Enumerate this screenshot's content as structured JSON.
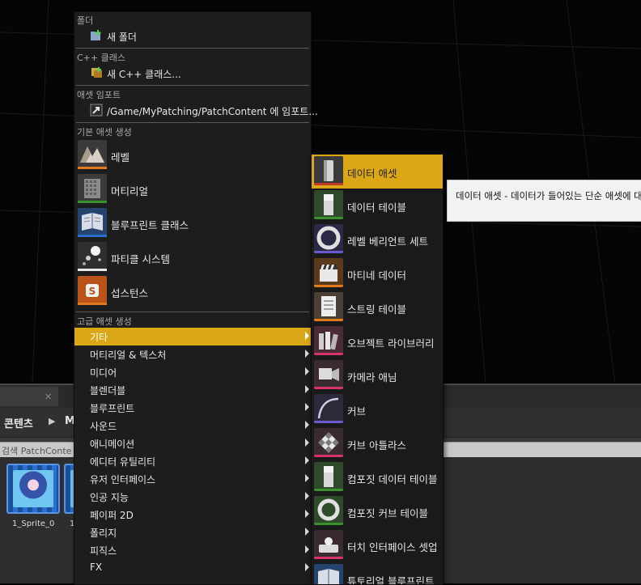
{
  "content_browser": {
    "path_root": "콘텐츠",
    "path_next": "M",
    "search_placeholder": "검색 PatchConte",
    "assets": [
      {
        "name": "1_Sprite_0"
      },
      {
        "name": "1"
      }
    ]
  },
  "menu": {
    "folder": {
      "header": "폴더",
      "new_folder": "새 폴더"
    },
    "cpp": {
      "header": "C++ 클래스",
      "new_cpp": "새 C++ 클래스..."
    },
    "import": {
      "header": "애셋 임포트",
      "import_label": "/Game/MyPatching/PatchContent 에 임포트..."
    },
    "basic": {
      "header": "기본 애셋 생성",
      "items": [
        {
          "label": "레벨",
          "icon": "level-icon",
          "color": "#e07a1a"
        },
        {
          "label": "머티리얼",
          "icon": "material-icon",
          "color": "#3a8f2e"
        },
        {
          "label": "블루프린트 클래스",
          "icon": "blueprint-icon",
          "color": "#2d6fd0"
        },
        {
          "label": "파티클 시스템",
          "icon": "particle-icon",
          "color": "#e8e8e8"
        },
        {
          "label": "섭스턴스",
          "icon": "substance-icon",
          "color": "#e07a1a"
        }
      ]
    },
    "advanced": {
      "header": "고급 애셋 생성",
      "items": [
        {
          "label": "기타"
        },
        {
          "label": "머티리얼 & 텍스처"
        },
        {
          "label": "미디어"
        },
        {
          "label": "블렌더블"
        },
        {
          "label": "블루프린트"
        },
        {
          "label": "사운드"
        },
        {
          "label": "애니메이션"
        },
        {
          "label": "에디터 유틸리티"
        },
        {
          "label": "유저 인터페이스"
        },
        {
          "label": "인공 지능"
        },
        {
          "label": "페이퍼 2D"
        },
        {
          "label": "폴리지"
        },
        {
          "label": "피직스"
        },
        {
          "label": "FX"
        }
      ]
    }
  },
  "submenu": {
    "items": [
      {
        "label": "데이터 애셋",
        "icon": "data-asset-icon",
        "color": "#c0392b"
      },
      {
        "label": "데이터 테이블",
        "icon": "data-table-icon",
        "color": "#3a8f2e"
      },
      {
        "label": "레벨 베리언트 세트",
        "icon": "level-variant-sets-icon",
        "color": "#6a5acd"
      },
      {
        "label": "마티네 데이터",
        "icon": "matinee-data-icon",
        "color": "#e07a1a"
      },
      {
        "label": "스트링 테이블",
        "icon": "string-table-icon",
        "color": "#e07a1a"
      },
      {
        "label": "오브젝트 라이브러리",
        "icon": "object-library-icon",
        "color": "#d6336c"
      },
      {
        "label": "카메라 애님",
        "icon": "camera-anim-icon",
        "color": "#d6336c"
      },
      {
        "label": "커브",
        "icon": "curve-icon",
        "color": "#6a5acd"
      },
      {
        "label": "커브 아틀라스",
        "icon": "curve-atlas-icon",
        "color": "#d6336c"
      },
      {
        "label": "컴포짓 데이터 테이블",
        "icon": "composite-data-table-icon",
        "color": "#3a8f2e"
      },
      {
        "label": "컴포짓 커브 테이블",
        "icon": "composite-curve-table-icon",
        "color": "#3a8f2e"
      },
      {
        "label": "터치 인터페이스 셋업",
        "icon": "touch-interface-icon",
        "color": "#d6336c"
      },
      {
        "label": "튜토리얼 블루프린트",
        "icon": "tutorial-blueprint-icon",
        "color": "#2d6fd0"
      }
    ]
  },
  "tooltip": {
    "text": "데이터 애셋 - 데이터가 들어있는 단순 애셋에 대"
  }
}
